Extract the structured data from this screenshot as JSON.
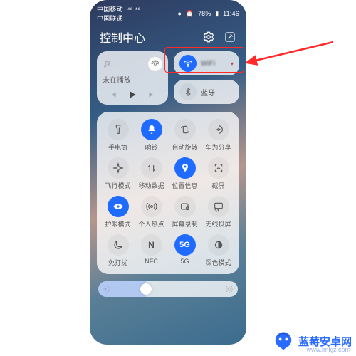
{
  "statusbar": {
    "carrier1": "中国移动",
    "carrier2": "中国联通",
    "signal": "⁴⁶ ⁴⁶",
    "rec": "●",
    "battery_pct": "78%",
    "time": "11:46"
  },
  "header": {
    "title": "控制中心"
  },
  "media": {
    "title": "未在播放"
  },
  "conn": {
    "wifi_label": "WiFi",
    "bt_label": "蓝牙"
  },
  "grid": [
    {
      "key": "flashlight",
      "label": "手电筒",
      "on": false
    },
    {
      "key": "ring",
      "label": "响铃",
      "on": true
    },
    {
      "key": "autorotate",
      "label": "自动旋转",
      "on": false
    },
    {
      "key": "huaweishare",
      "label": "华为分享",
      "on": false
    },
    {
      "key": "airplane",
      "label": "飞行模式",
      "on": false
    },
    {
      "key": "mobiledata",
      "label": "移动数据",
      "on": false
    },
    {
      "key": "location",
      "label": "位置信息",
      "on": true
    },
    {
      "key": "screenshot",
      "label": "截屏",
      "on": false
    },
    {
      "key": "eyecomfort",
      "label": "护眼模式",
      "on": true
    },
    {
      "key": "hotspot",
      "label": "个人热点",
      "on": false
    },
    {
      "key": "screenrec",
      "label": "屏幕录制",
      "on": false
    },
    {
      "key": "wirelesscast",
      "label": "无线投屏",
      "on": false
    },
    {
      "key": "dnd",
      "label": "免打扰",
      "on": false
    },
    {
      "key": "nfc",
      "label": "NFC",
      "on": false
    },
    {
      "key": "5g",
      "label": "5G",
      "on": true
    },
    {
      "key": "darkmode",
      "label": "深色模式",
      "on": false
    }
  ],
  "brightness": {
    "value": 34
  },
  "watermark": {
    "text": "蓝莓安卓网",
    "url": "www.lmkjz.com"
  },
  "colors": {
    "accent": "#1f6bff",
    "highlight": "#ff2a2a"
  }
}
